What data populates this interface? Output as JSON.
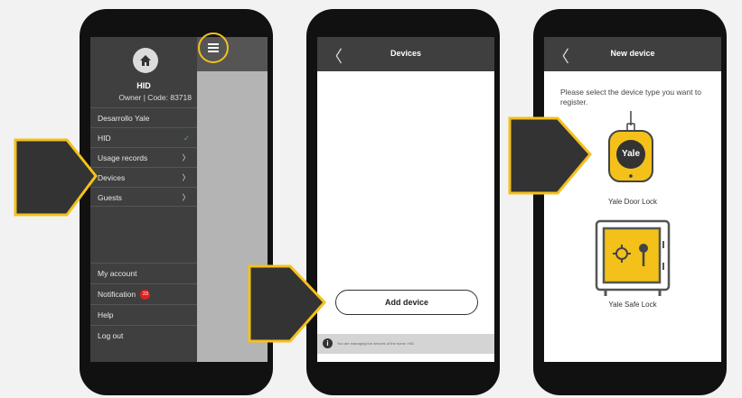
{
  "screen1": {
    "user_name": "HID",
    "owner_line": "Owner | Code: 83718",
    "home_name": "Desarrollo Yale",
    "menu_items": [
      {
        "label": "HID",
        "right": "✓"
      },
      {
        "label": "Usage records",
        "right": "〉"
      },
      {
        "label": "Devices",
        "right": "〉"
      },
      {
        "label": "Guests",
        "right": "〉"
      }
    ],
    "bottom_items": [
      {
        "label": "My account"
      },
      {
        "label": "Notification",
        "badge": "23"
      },
      {
        "label": "Help"
      },
      {
        "label": "Log out"
      }
    ]
  },
  "screen2": {
    "title": "Devices",
    "back": "〈",
    "add_button": "Add device",
    "info_text": "You are managing the devices of the home: HID"
  },
  "screen3": {
    "title": "New device",
    "back": "〈",
    "intro": "Please select the device type you want to register.",
    "door_logo": "Yale",
    "door_label": "Yale Door Lock",
    "safe_label": "Yale Safe Lock"
  },
  "colors": {
    "accent": "#f3c11a",
    "header": "#3f3f3f",
    "check": "#4caf50",
    "badge": "#e02020"
  }
}
